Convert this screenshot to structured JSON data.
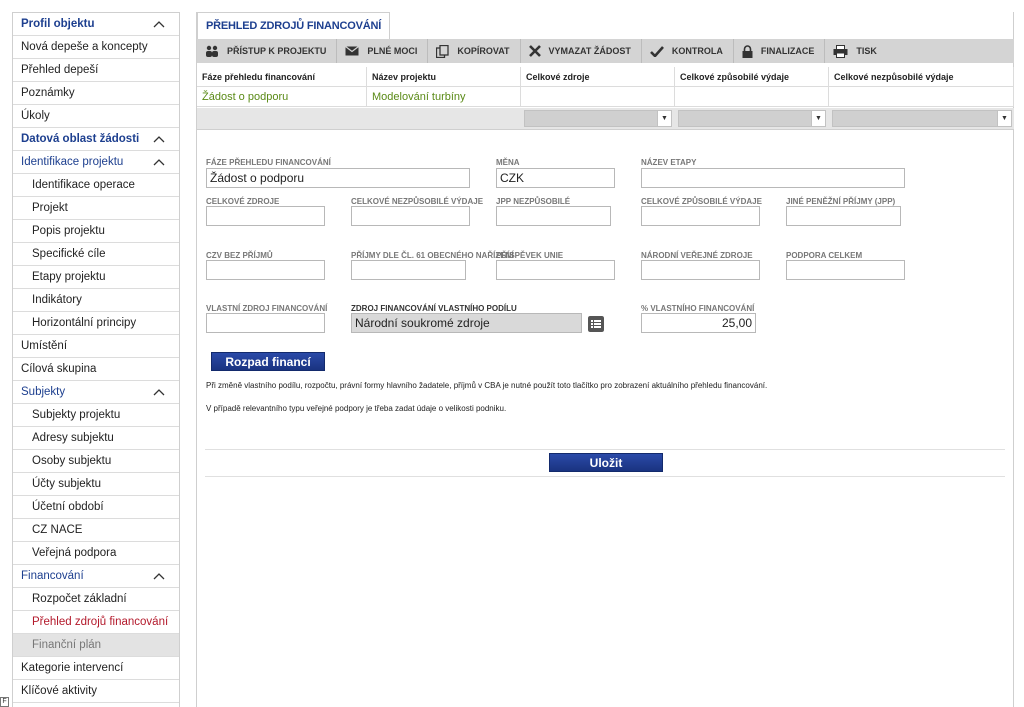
{
  "sidebar": {
    "items": [
      {
        "label": "Profil objektu"
      },
      {
        "label": "Nová depeše a koncepty"
      },
      {
        "label": "Přehled depeší"
      },
      {
        "label": "Poznámky"
      },
      {
        "label": "Úkoly"
      },
      {
        "label": "Datová oblast žádosti"
      },
      {
        "label": "Identifikace projektu"
      },
      {
        "label": "Identifikace operace"
      },
      {
        "label": "Projekt"
      },
      {
        "label": "Popis projektu"
      },
      {
        "label": "Specifické cíle"
      },
      {
        "label": "Etapy projektu"
      },
      {
        "label": "Indikátory"
      },
      {
        "label": "Horizontální principy"
      },
      {
        "label": "Umístění"
      },
      {
        "label": "Cílová skupina"
      },
      {
        "label": "Subjekty"
      },
      {
        "label": "Subjekty projektu"
      },
      {
        "label": "Adresy subjektu"
      },
      {
        "label": "Osoby subjektu"
      },
      {
        "label": "Účty subjektu"
      },
      {
        "label": "Účetní období"
      },
      {
        "label": "CZ NACE"
      },
      {
        "label": "Veřejná podpora"
      },
      {
        "label": "Financování"
      },
      {
        "label": "Rozpočet základní"
      },
      {
        "label": "Přehled zdrojů financování"
      },
      {
        "label": "Finanční plán"
      },
      {
        "label": "Kategorie intervencí"
      },
      {
        "label": "Klíčové aktivity"
      }
    ]
  },
  "tab": {
    "title": "PŘEHLED ZDROJŮ FINANCOVÁNÍ"
  },
  "toolbar": {
    "access": "PŘÍSTUP K PROJEKTU",
    "proxies": "PLNÉ MOCI",
    "copy": "KOPÍROVAT",
    "delete": "VYMAZAT ŽÁDOST",
    "check": "KONTROLA",
    "finalize": "FINALIZACE",
    "print": "TISK"
  },
  "grid": {
    "headers": [
      "Fáze přehledu financování",
      "Název projektu",
      "Celkové zdroje",
      "Celkové způsobilé výdaje",
      "Celkové nezpůsobilé výdaje"
    ],
    "row": [
      "Žádost o podporu",
      "Modelování turbíny",
      "",
      "",
      ""
    ]
  },
  "form": {
    "phase_label": "FÁZE PŘEHLEDU FINANCOVÁNÍ",
    "phase_value": "Žádost o podporu",
    "currency_label": "MĚNA",
    "currency_value": "CZK",
    "stage_label": "NÁZEV ETAPY",
    "stage_value": "",
    "total_sources_label": "CELKOVÉ ZDROJE",
    "total_ineligible_label": "CELKOVÉ NEZPŮSOBILÉ VÝDAJE",
    "jpp_ineligible_label": "JPP NEZPŮSOBILÉ",
    "total_eligible_label": "CELKOVÉ ZPŮSOBILÉ VÝDAJE",
    "other_income_label": "JINÉ PENĚŽNÍ PŘÍJMY (JPP)",
    "czv_label": "CZV BEZ PŘÍJMŮ",
    "income61_label": "PŘÍJMY DLE ČL. 61 OBECNÉHO NAŘÍZENÍ",
    "eu_contrib_label": "PŘÍSPĚVEK UNIE",
    "national_label": "NÁRODNÍ VEŘEJNÉ ZDROJE",
    "support_total_label": "PODPORA CELKEM",
    "own_source_label": "VLASTNÍ ZDROJ FINANCOVÁNÍ",
    "own_source_type_label": "ZDROJ FINANCOVÁNÍ VLASTNÍHO PODÍLU",
    "own_source_type_value": "Národní soukromé zdroje",
    "own_pct_label": "% VLASTNÍHO FINANCOVÁNÍ",
    "own_pct_value": "25,00",
    "breakdown_button": "Rozpad financí",
    "note1": "Při změně vlastního podílu, rozpočtu, právní formy hlavního žadatele, příjmů v CBA je nutné použít toto tlačítko pro zobrazení aktuálního přehledu financování.",
    "note2": "V případě relevantního typu veřejné podpory je třeba zadat údaje o velikosti podniku.",
    "save_button": "Uložit"
  },
  "corner_glyph": "F",
  "colors": {
    "accent": "#1d3f8f",
    "active": "#b3192b",
    "grid_value": "#5a8a16",
    "button": "#1a3380"
  }
}
